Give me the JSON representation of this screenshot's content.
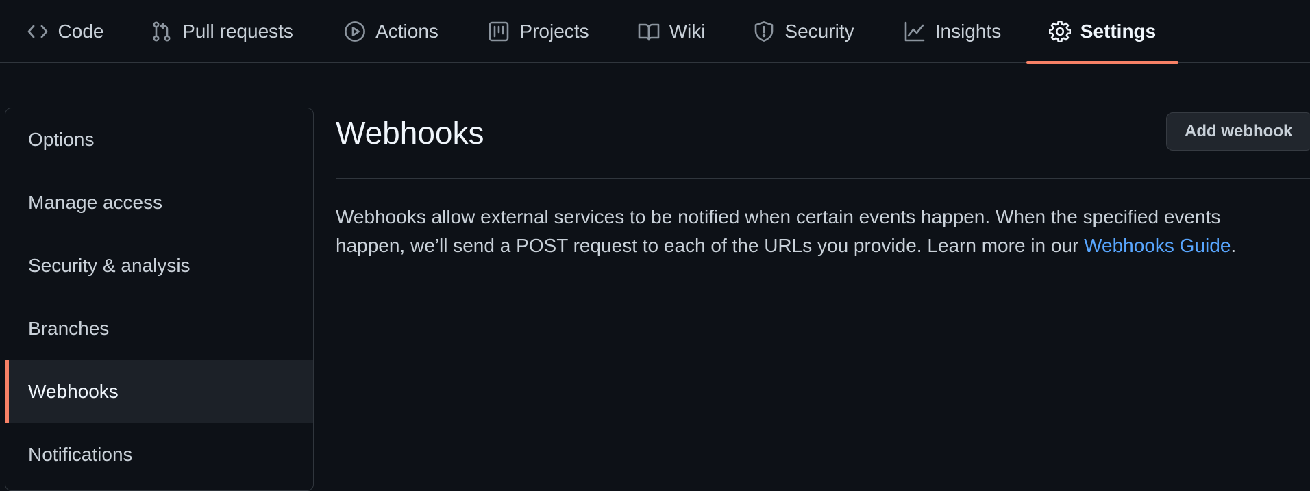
{
  "tabs": [
    {
      "label": "Code",
      "icon": "code-icon"
    },
    {
      "label": "Pull requests",
      "icon": "pull-request-icon"
    },
    {
      "label": "Actions",
      "icon": "play-icon"
    },
    {
      "label": "Projects",
      "icon": "project-icon"
    },
    {
      "label": "Wiki",
      "icon": "book-icon"
    },
    {
      "label": "Security",
      "icon": "shield-icon"
    },
    {
      "label": "Insights",
      "icon": "graph-icon"
    },
    {
      "label": "Settings",
      "icon": "gear-icon",
      "active": true
    }
  ],
  "sidebar": {
    "items": [
      {
        "label": "Options"
      },
      {
        "label": "Manage access"
      },
      {
        "label": "Security & analysis"
      },
      {
        "label": "Branches"
      },
      {
        "label": "Webhooks",
        "selected": true
      },
      {
        "label": "Notifications"
      }
    ]
  },
  "main": {
    "title": "Webhooks",
    "add_button": "Add webhook",
    "description": {
      "line1": "Webhooks allow external services to be notified when certain events happen. When the specified events",
      "line2_prefix": "happen, we’ll send a POST request to each of the URLs you provide. Learn more in our ",
      "link": "Webhooks Guide",
      "suffix": "."
    }
  },
  "colors": {
    "background": "#0d1117",
    "accent_underline": "#f78166",
    "link": "#58a6ff",
    "border": "#30363d"
  }
}
